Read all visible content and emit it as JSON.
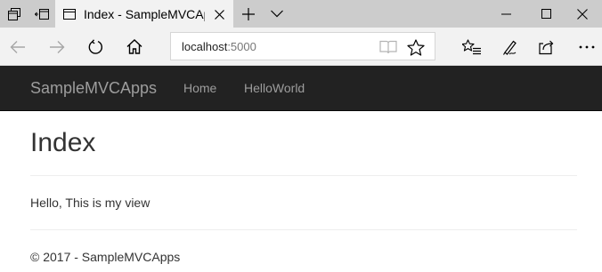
{
  "browser": {
    "tab": {
      "title": "Index - SampleMVCApps"
    },
    "address": {
      "host": "localhost",
      "port": ":5000"
    }
  },
  "site": {
    "brand": "SampleMVCApps",
    "nav": [
      {
        "label": "Home"
      },
      {
        "label": "HelloWorld"
      }
    ]
  },
  "main": {
    "title": "Index",
    "message": "Hello, This is my view"
  },
  "footer": {
    "text": "© 2017 - SampleMVCApps"
  },
  "icons": {
    "tab_strip": [
      "tab-list-icon",
      "set-aside-tabs-icon",
      "page-favicon-icon",
      "close-icon",
      "new-tab-icon",
      "tab-preview-chevron-icon"
    ],
    "window": [
      "minimize-icon",
      "maximize-icon",
      "close-window-icon"
    ],
    "toolbar": [
      "back-icon",
      "forward-icon",
      "refresh-icon",
      "home-icon",
      "reading-view-icon",
      "favorite-star-icon",
      "favorites-list-icon",
      "pen-icon",
      "share-icon",
      "more-icon"
    ]
  },
  "colors": {
    "tabstrip": "#cccccc",
    "toolbar": "#f2f2f2",
    "navbar": "#222222",
    "nav_text": "#9d9d9d",
    "text": "#333333"
  }
}
